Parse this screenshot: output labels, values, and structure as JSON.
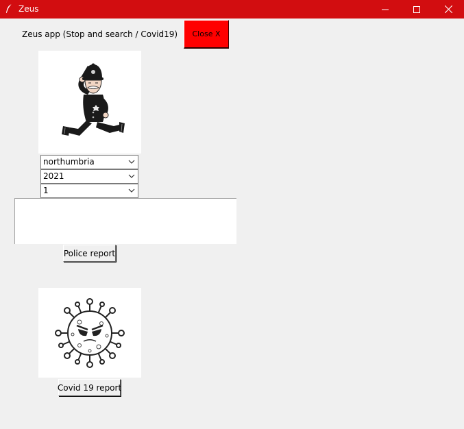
{
  "window": {
    "title": "Zeus",
    "title_bar_color": "#d20d10",
    "controls": {
      "minimize_icon": "minimize-icon",
      "maximize_icon": "maximize-icon",
      "close_icon": "close-icon"
    }
  },
  "header": {
    "app_label": "Zeus app (Stop and search / Covid19)",
    "close_button_label": "Close X",
    "close_button_color": "#ff0000"
  },
  "police_section": {
    "image": "police-officer-cartoon",
    "force_select": {
      "value": "northumbria"
    },
    "year_select": {
      "value": "2021"
    },
    "month_select": {
      "value": "1"
    },
    "output_text": "",
    "report_button_label": "Police report"
  },
  "covid_section": {
    "image": "coronavirus-cartoon",
    "report_button_label": "Covid 19 report"
  }
}
